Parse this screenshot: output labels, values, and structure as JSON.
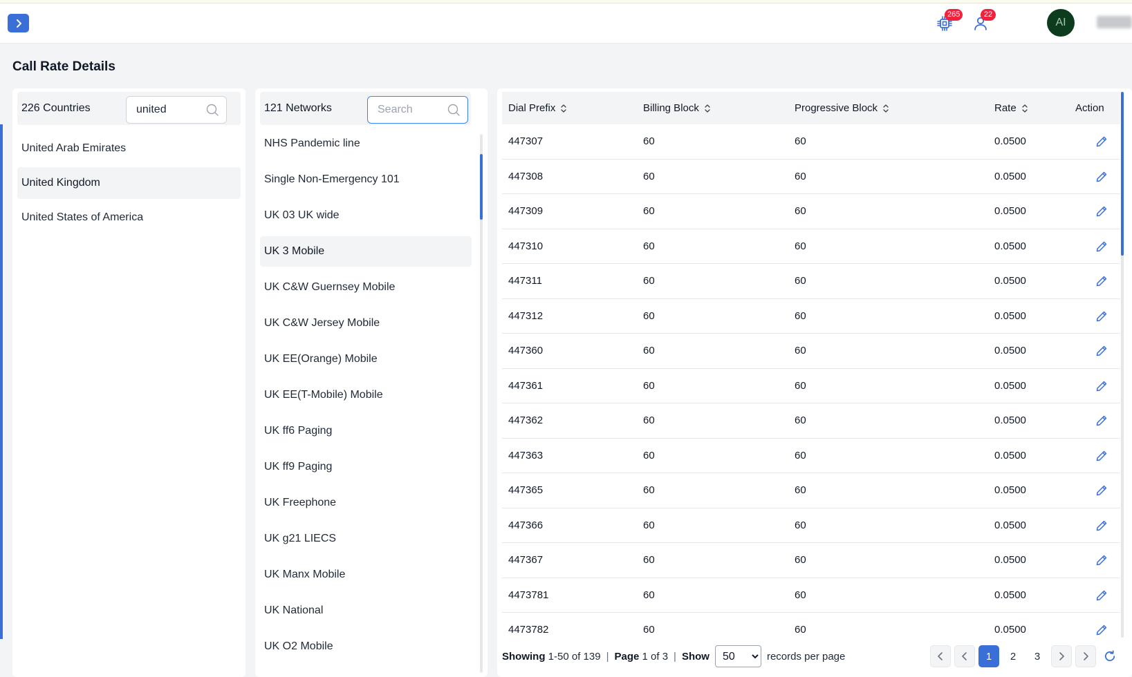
{
  "header": {
    "expand_icon": "chevron-right-icon",
    "chip_badge": "265",
    "user_badge": "22",
    "avatar_initials": "AI"
  },
  "page": {
    "title": "Call Rate Details"
  },
  "countries": {
    "count_label": "226 Countries",
    "search_value": "united",
    "search_placeholder": "",
    "items": [
      {
        "label": "United Arab Emirates",
        "selected": false
      },
      {
        "label": "United Kingdom",
        "selected": true
      },
      {
        "label": "United States of America",
        "selected": false
      }
    ]
  },
  "networks": {
    "count_label": "121 Networks",
    "search_value": "",
    "search_placeholder": "Search",
    "items": [
      {
        "label": "NHS Pandemic line",
        "selected": false
      },
      {
        "label": "Single Non-Emergency 101",
        "selected": false
      },
      {
        "label": "UK 03 UK wide",
        "selected": false
      },
      {
        "label": "UK 3 Mobile",
        "selected": true
      },
      {
        "label": "UK C&W Guernsey Mobile",
        "selected": false
      },
      {
        "label": "UK C&W Jersey Mobile",
        "selected": false
      },
      {
        "label": "UK EE(Orange) Mobile",
        "selected": false
      },
      {
        "label": "UK EE(T-Mobile) Mobile",
        "selected": false
      },
      {
        "label": "UK ff6 Paging",
        "selected": false
      },
      {
        "label": "UK ff9 Paging",
        "selected": false
      },
      {
        "label": "UK Freephone",
        "selected": false
      },
      {
        "label": "UK g21 LIECS",
        "selected": false
      },
      {
        "label": "UK Manx Mobile",
        "selected": false
      },
      {
        "label": "UK National",
        "selected": false
      },
      {
        "label": "UK O2 Mobile",
        "selected": false
      }
    ]
  },
  "rates": {
    "columns": {
      "dial_prefix": "Dial Prefix",
      "billing_block": "Billing Block",
      "progressive_block": "Progressive Block",
      "rate": "Rate",
      "action": "Action"
    },
    "rows": [
      {
        "prefix": "447307",
        "billing": "60",
        "progressive": "60",
        "rate": "0.0500"
      },
      {
        "prefix": "447308",
        "billing": "60",
        "progressive": "60",
        "rate": "0.0500"
      },
      {
        "prefix": "447309",
        "billing": "60",
        "progressive": "60",
        "rate": "0.0500"
      },
      {
        "prefix": "447310",
        "billing": "60",
        "progressive": "60",
        "rate": "0.0500"
      },
      {
        "prefix": "447311",
        "billing": "60",
        "progressive": "60",
        "rate": "0.0500"
      },
      {
        "prefix": "447312",
        "billing": "60",
        "progressive": "60",
        "rate": "0.0500"
      },
      {
        "prefix": "447360",
        "billing": "60",
        "progressive": "60",
        "rate": "0.0500"
      },
      {
        "prefix": "447361",
        "billing": "60",
        "progressive": "60",
        "rate": "0.0500"
      },
      {
        "prefix": "447362",
        "billing": "60",
        "progressive": "60",
        "rate": "0.0500"
      },
      {
        "prefix": "447363",
        "billing": "60",
        "progressive": "60",
        "rate": "0.0500"
      },
      {
        "prefix": "447365",
        "billing": "60",
        "progressive": "60",
        "rate": "0.0500"
      },
      {
        "prefix": "447366",
        "billing": "60",
        "progressive": "60",
        "rate": "0.0500"
      },
      {
        "prefix": "447367",
        "billing": "60",
        "progressive": "60",
        "rate": "0.0500"
      },
      {
        "prefix": "4473781",
        "billing": "60",
        "progressive": "60",
        "rate": "0.0500"
      },
      {
        "prefix": "4473782",
        "billing": "60",
        "progressive": "60",
        "rate": "0.0500"
      }
    ],
    "edit_icon": "pencil-icon",
    "sort_icon": "sort-icon"
  },
  "pagination": {
    "showing_label": "Showing",
    "showing_value": "1-50 of 139",
    "page_label": "Page",
    "page_value": "1 of 3",
    "show_label": "Show",
    "page_size": "50",
    "records_label": "records per page",
    "pages": [
      "1",
      "2",
      "3"
    ],
    "current_page": "1"
  },
  "colors": {
    "accent": "#3b6fd8",
    "badge": "#ef233c",
    "avatar_bg": "#0d3b1e"
  }
}
